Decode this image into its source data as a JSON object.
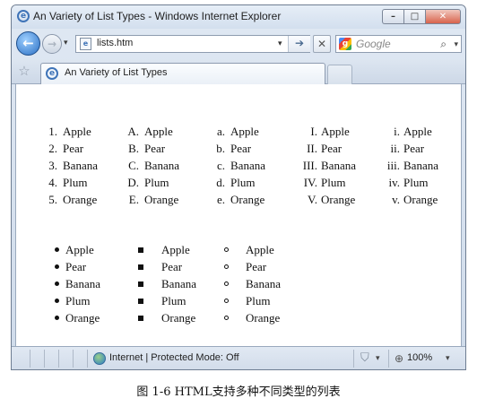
{
  "window": {
    "title": "An Variety of List Types - Windows Internet Explorer",
    "minimize": "–",
    "maximize": "□",
    "close": "✕"
  },
  "nav": {
    "back": "←",
    "forward": "→",
    "recent": "▾",
    "address": "lists.htm",
    "address_dropdown": "▾",
    "go": "➔",
    "stop": "✕",
    "search_placeholder": "Google",
    "search_button": "⌕",
    "search_dropdown": "▾"
  },
  "tabs": {
    "favorites_icon": "star-icon",
    "active_tab_label": "An Variety of List Types"
  },
  "content": {
    "ordered_lists": [
      {
        "type": "decimal",
        "markers": [
          "1.",
          "2.",
          "3.",
          "4.",
          "5."
        ],
        "items": [
          "Apple",
          "Pear",
          "Banana",
          "Plum",
          "Orange"
        ]
      },
      {
        "type": "upper-alpha",
        "markers": [
          "A.",
          "B.",
          "C.",
          "D.",
          "E."
        ],
        "items": [
          "Apple",
          "Pear",
          "Banana",
          "Plum",
          "Orange"
        ]
      },
      {
        "type": "lower-alpha",
        "markers": [
          "a.",
          "b.",
          "c.",
          "d.",
          "e."
        ],
        "items": [
          "Apple",
          "Pear",
          "Banana",
          "Plum",
          "Orange"
        ]
      },
      {
        "type": "upper-roman",
        "markers": [
          "I.",
          "II.",
          "III.",
          "IV.",
          "V."
        ],
        "items": [
          "Apple",
          "Pear",
          "Banana",
          "Plum",
          "Orange"
        ]
      },
      {
        "type": "lower-roman",
        "markers": [
          "i.",
          "ii.",
          "iii.",
          "iv.",
          "v."
        ],
        "items": [
          "Apple",
          "Pear",
          "Banana",
          "Plum",
          "Orange"
        ]
      }
    ],
    "unordered_lists": [
      {
        "type": "disc",
        "items": [
          "Apple",
          "Pear",
          "Banana",
          "Plum",
          "Orange"
        ]
      },
      {
        "type": "square",
        "items": [
          "Apple",
          "Pear",
          "Banana",
          "Plum",
          "Orange"
        ]
      },
      {
        "type": "circle",
        "items": [
          "Apple",
          "Pear",
          "Banana",
          "Plum",
          "Orange"
        ]
      }
    ]
  },
  "status": {
    "zone": "Internet | Protected Mode: Off",
    "zoom": "100%",
    "dropdown": "▾"
  },
  "caption": "图 1-6   HTML支持多种不同类型的列表",
  "colors": {
    "accent": "#3f74b8",
    "chrome": "#d3dfee",
    "close_button": "#d8634c"
  }
}
